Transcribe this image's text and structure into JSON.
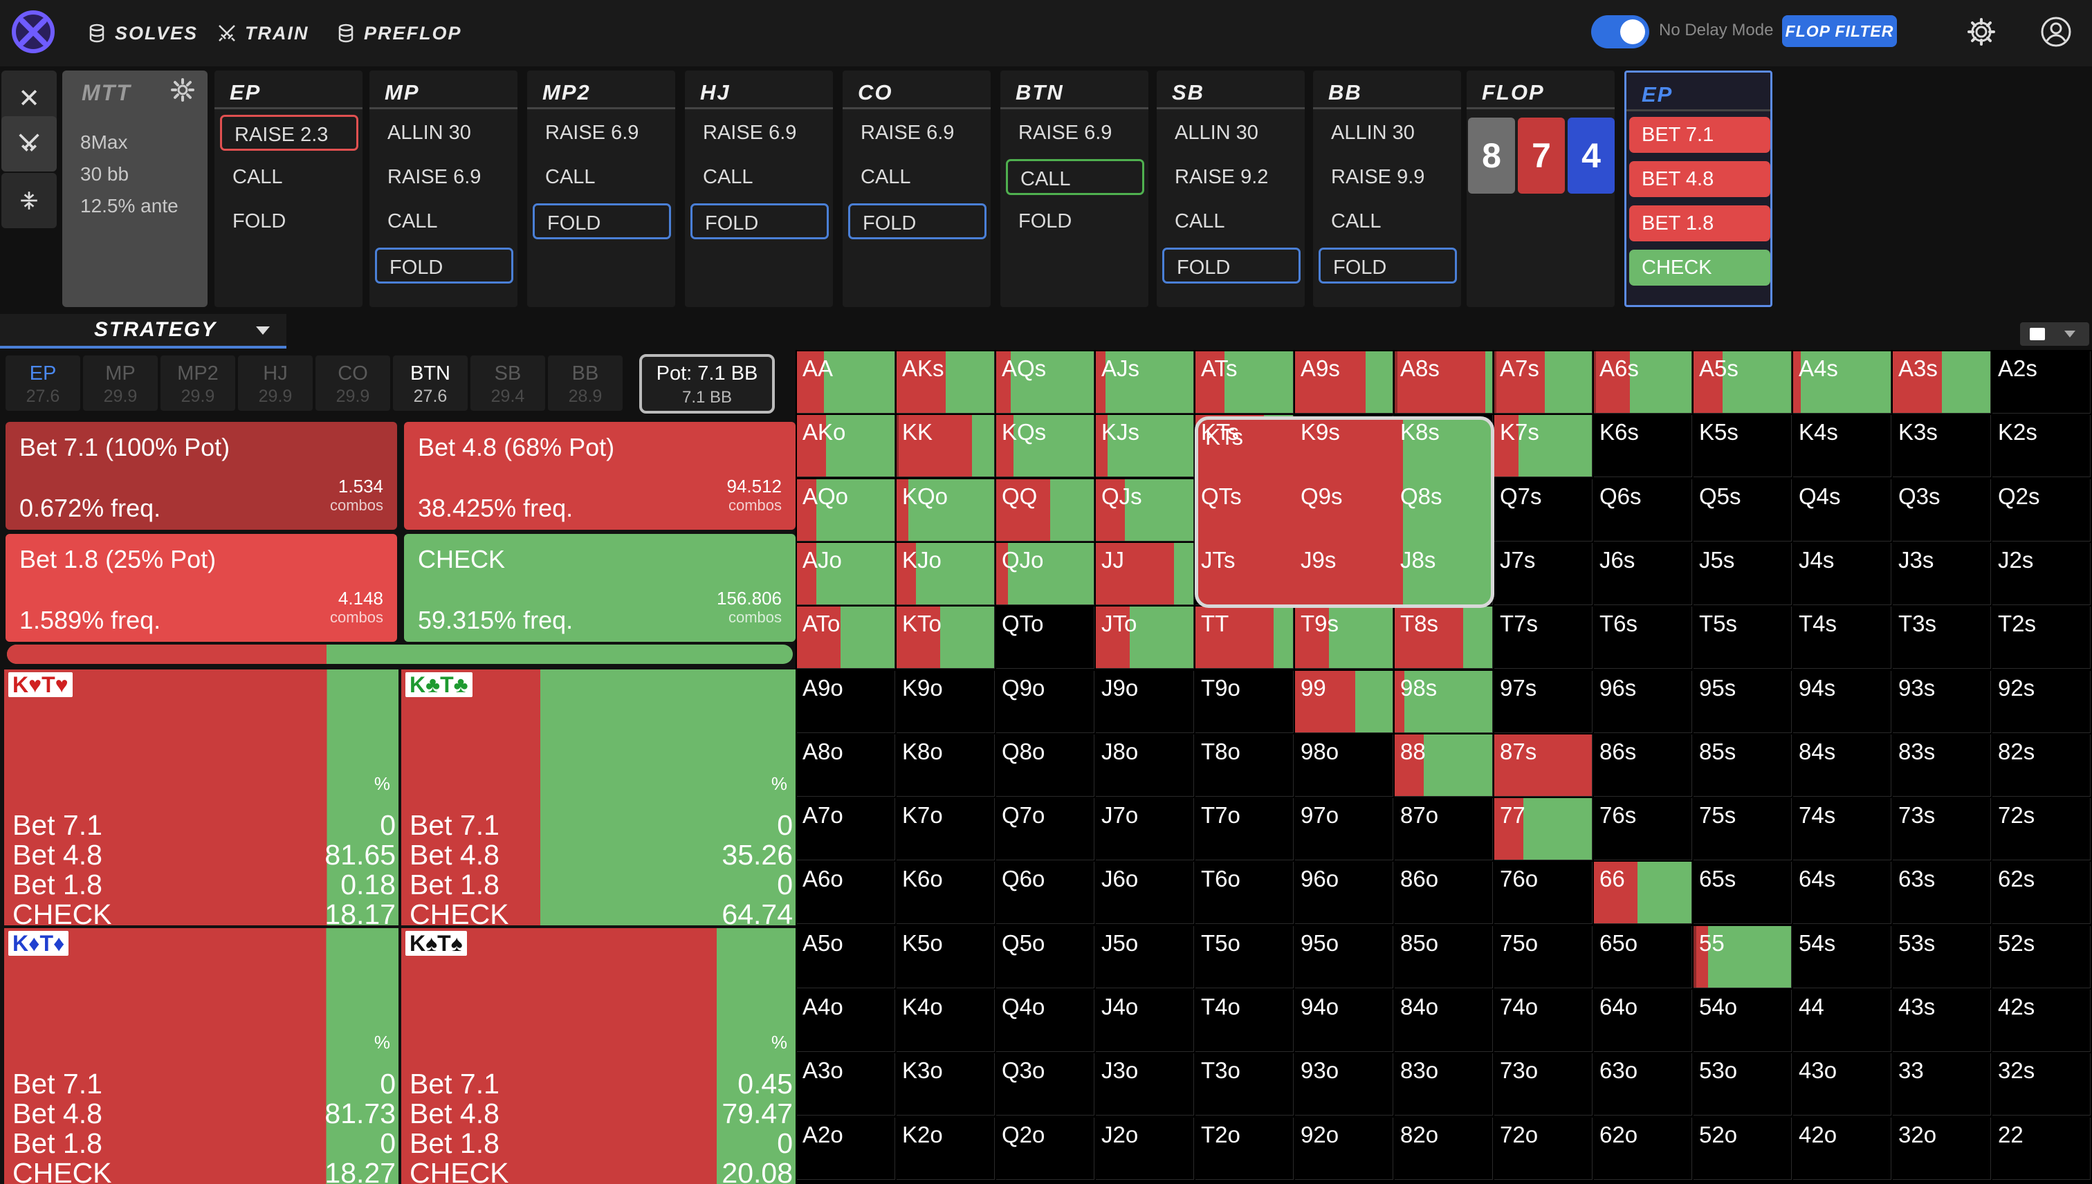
{
  "nav": {
    "solves": "SOLVES",
    "train": "TRAIN",
    "preflop": "PREFLOP"
  },
  "topbar": {
    "no_delay_label": "No Delay Mode",
    "flop_filter": "FLOP FILTER",
    "no_delay_on": true
  },
  "mtt": {
    "title": "MTT",
    "players": "8Max",
    "stack": "30 bb",
    "ante": "12.5% ante"
  },
  "columns": [
    {
      "name": "EP",
      "actions": [
        "RAISE 2.3",
        "CALL",
        "FOLD"
      ],
      "selected": 0,
      "sel_color": "red"
    },
    {
      "name": "MP",
      "actions": [
        "ALLIN 30",
        "RAISE 6.9",
        "CALL",
        "FOLD"
      ],
      "selected": 3,
      "sel_color": "blue"
    },
    {
      "name": "MP2",
      "actions": [
        "RAISE 6.9",
        "CALL",
        "FOLD"
      ],
      "selected": 2,
      "sel_color": "blue"
    },
    {
      "name": "HJ",
      "actions": [
        "RAISE 6.9",
        "CALL",
        "FOLD"
      ],
      "selected": 2,
      "sel_color": "blue"
    },
    {
      "name": "CO",
      "actions": [
        "RAISE 6.9",
        "CALL",
        "FOLD"
      ],
      "selected": 2,
      "sel_color": "blue"
    },
    {
      "name": "BTN",
      "actions": [
        "RAISE 6.9",
        "CALL",
        "FOLD"
      ],
      "selected": 1,
      "sel_color": "green"
    },
    {
      "name": "SB",
      "actions": [
        "ALLIN 30",
        "RAISE 9.2",
        "CALL",
        "FOLD"
      ],
      "selected": 3,
      "sel_color": "blue"
    },
    {
      "name": "BB",
      "actions": [
        "ALLIN 30",
        "RAISE 9.9",
        "CALL",
        "FOLD"
      ],
      "selected": 3,
      "sel_color": "blue"
    }
  ],
  "flop": {
    "name": "FLOP",
    "cards": [
      {
        "rank": "8",
        "color": "#6e6e6e"
      },
      {
        "rank": "7",
        "color": "#c43a3a"
      },
      {
        "rank": "4",
        "color": "#2f4fd0"
      }
    ]
  },
  "ep_decision": {
    "name": "EP",
    "actions": [
      "BET 7.1",
      "BET 4.8",
      "BET 1.8",
      "CHECK"
    ]
  },
  "strategy": {
    "tab": "STRATEGY"
  },
  "positions": [
    {
      "name": "EP",
      "stack": "27.6",
      "state": "ep"
    },
    {
      "name": "MP",
      "stack": "29.9",
      "state": "off"
    },
    {
      "name": "MP2",
      "stack": "29.9",
      "state": "off"
    },
    {
      "name": "HJ",
      "stack": "29.9",
      "state": "off"
    },
    {
      "name": "CO",
      "stack": "29.9",
      "state": "off"
    },
    {
      "name": "BTN",
      "stack": "27.6",
      "state": "on"
    },
    {
      "name": "SB",
      "stack": "29.4",
      "state": "off"
    },
    {
      "name": "BB",
      "stack": "28.9",
      "state": "off"
    }
  ],
  "pot": {
    "main": "Pot: 7.1 BB",
    "sub": "7.1 BB"
  },
  "action_summary": [
    {
      "label": "Bet 7.1 (100% Pot)",
      "freq": "0.672% freq.",
      "combos": "1.534",
      "combos_label": "combos",
      "color": "#a83434"
    },
    {
      "label": "Bet 4.8 (68% Pot)",
      "freq": "38.425% freq.",
      "combos": "94.512",
      "combos_label": "combos",
      "color": "#cf4040"
    },
    {
      "label": "Bet 1.8 (25% Pot)",
      "freq": "1.589% freq.",
      "combos": "4.148",
      "combos_label": "combos",
      "color": "#e34a4a"
    },
    {
      "label": "CHECK",
      "freq": "59.315% freq.",
      "combos": "156.806",
      "combos_label": "combos",
      "color": "#6db96b"
    }
  ],
  "freq_bar": {
    "red_share": 0.407
  },
  "combos": [
    {
      "hand": "K♥T♥",
      "suit_color": "#d02020",
      "pct_label": "%",
      "values": {
        "b71": "0",
        "b48": "81.65",
        "b18": "0.18",
        "chk": "18.17"
      },
      "red_share": 0.818
    },
    {
      "hand": "K♣T♣",
      "suit_color": "#1e9a30",
      "pct_label": "%",
      "values": {
        "b71": "0",
        "b48": "35.26",
        "b18": "0",
        "chk": "64.74"
      },
      "red_share": 0.353
    },
    {
      "hand": "K♦T♦",
      "suit_color": "#2040d0",
      "pct_label": "%",
      "values": {
        "b71": "0",
        "b48": "81.73",
        "b18": "0",
        "chk": "18.27"
      },
      "red_share": 0.817
    },
    {
      "hand": "K♠T♠",
      "suit_color": "#111111",
      "pct_label": "%",
      "values": {
        "b71": "0.45",
        "b48": "79.47",
        "b18": "0",
        "chk": "20.08"
      },
      "red_share": 0.8
    }
  ],
  "combo_row_labels": {
    "b71": "Bet 7.1",
    "b48": "Bet 4.8",
    "b18": "Bet 1.8",
    "chk": "CHECK"
  },
  "grid": {
    "ranks": [
      "A",
      "K",
      "Q",
      "J",
      "T",
      "9",
      "8",
      "7",
      "6",
      "5",
      "4",
      "3",
      "2"
    ],
    "strategy": {
      "AA": [
        0,
        0.28
      ],
      "AKs": [
        0,
        0.5
      ],
      "AQs": [
        0,
        0.15
      ],
      "AJs": [
        0,
        0.1
      ],
      "ATs": [
        0,
        0.3
      ],
      "A9s": [
        0,
        0.72
      ],
      "A8s": [
        0.03,
        0.9
      ],
      "A7s": [
        0.02,
        0.5
      ],
      "A6s": [
        0.02,
        0.35
      ],
      "A5s": [
        0,
        0.3
      ],
      "A4s": [
        0,
        0.08
      ],
      "A3s": [
        0,
        0.5
      ],
      "AKo": [
        0,
        0.3
      ],
      "KK": [
        0.02,
        0.75
      ],
      "KQs": [
        0,
        0.18
      ],
      "KJs": [
        0,
        0.12
      ],
      "KTs": [
        0,
        0.7
      ],
      "K7s": [
        0,
        0.25
      ],
      "AQo": [
        0,
        0.2
      ],
      "KQo": [
        0,
        0.12
      ],
      "QQ": [
        0,
        0.55
      ],
      "QJs": [
        0,
        0.3
      ],
      "AJo": [
        0,
        0.2
      ],
      "KJo": [
        0,
        0.2
      ],
      "QJo": [
        0,
        0.12
      ],
      "JJ": [
        0,
        0.8
      ],
      "ATo": [
        0,
        0.45
      ],
      "KTo": [
        0,
        0.45
      ],
      "JTo": [
        0,
        0.35
      ],
      "TT": [
        0,
        0.8
      ],
      "T9s": [
        0,
        0.35
      ],
      "T8s": [
        0,
        0.7
      ],
      "99": [
        0,
        0.62
      ],
      "98s": [
        0,
        0.1
      ],
      "88": [
        0,
        0.3
      ],
      "87s": [
        0,
        1.0
      ],
      "77": [
        0,
        0.3
      ],
      "66": [
        0,
        0.45
      ],
      "55": [
        0.03,
        0.12
      ]
    }
  }
}
